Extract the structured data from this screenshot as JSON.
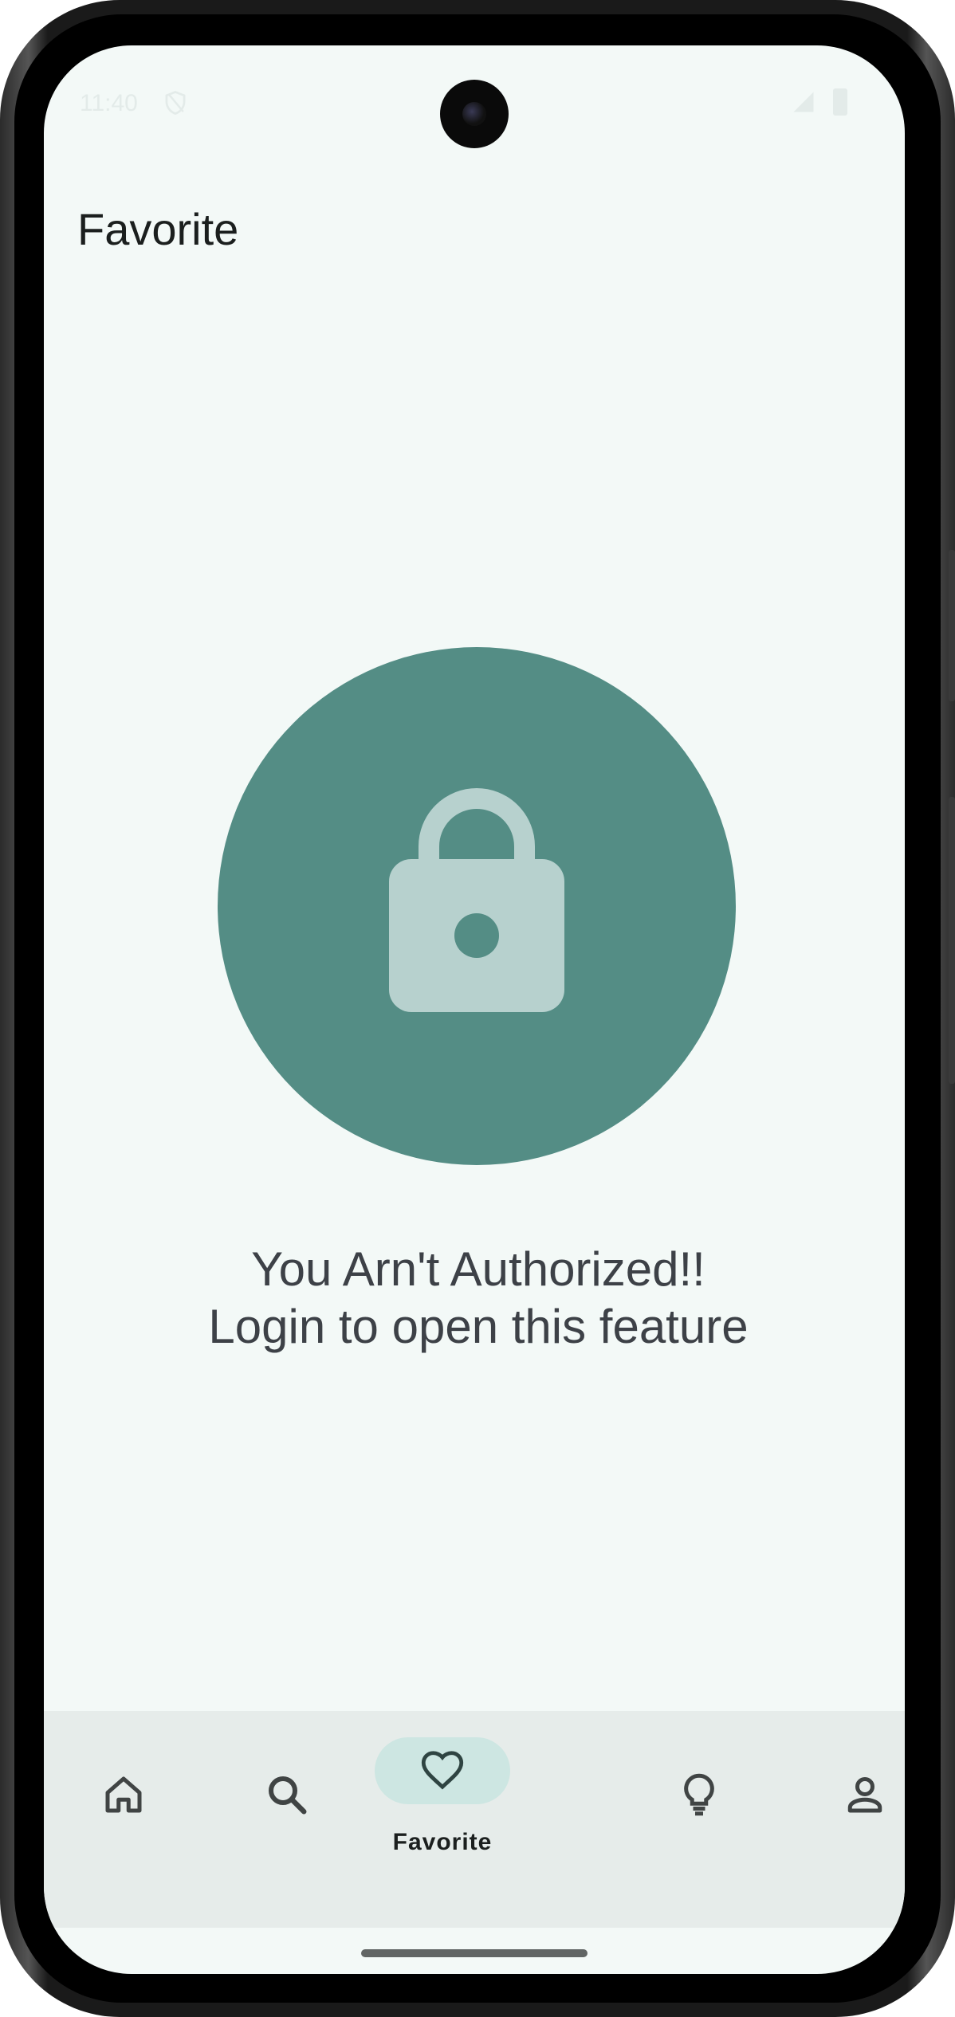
{
  "status_bar": {
    "time": "11:40"
  },
  "header": {
    "title": "Favorite"
  },
  "locked_state": {
    "icon": "lock-icon",
    "message_line1": "You Arn't Authorized!!",
    "message_line2": "Login to open this feature"
  },
  "bottom_nav": {
    "items": [
      {
        "icon": "home-icon",
        "label": "Home",
        "selected": false
      },
      {
        "icon": "search-icon",
        "label": "Search",
        "selected": false
      },
      {
        "icon": "heart-icon",
        "label": "Favorite",
        "selected": true
      },
      {
        "icon": "lightbulb-icon",
        "label": "Ideas",
        "selected": false
      },
      {
        "icon": "person-icon",
        "label": "Profile",
        "selected": false
      }
    ]
  },
  "colors": {
    "screen_background": "#f3f9f7",
    "accent_circle": "#548d85",
    "lock_glyph": "#b7d1ce",
    "nav_background": "#e6ecea",
    "nav_selected_pill": "#cde6e2",
    "text_primary": "#1b1f1e",
    "text_message": "#3d4147"
  }
}
